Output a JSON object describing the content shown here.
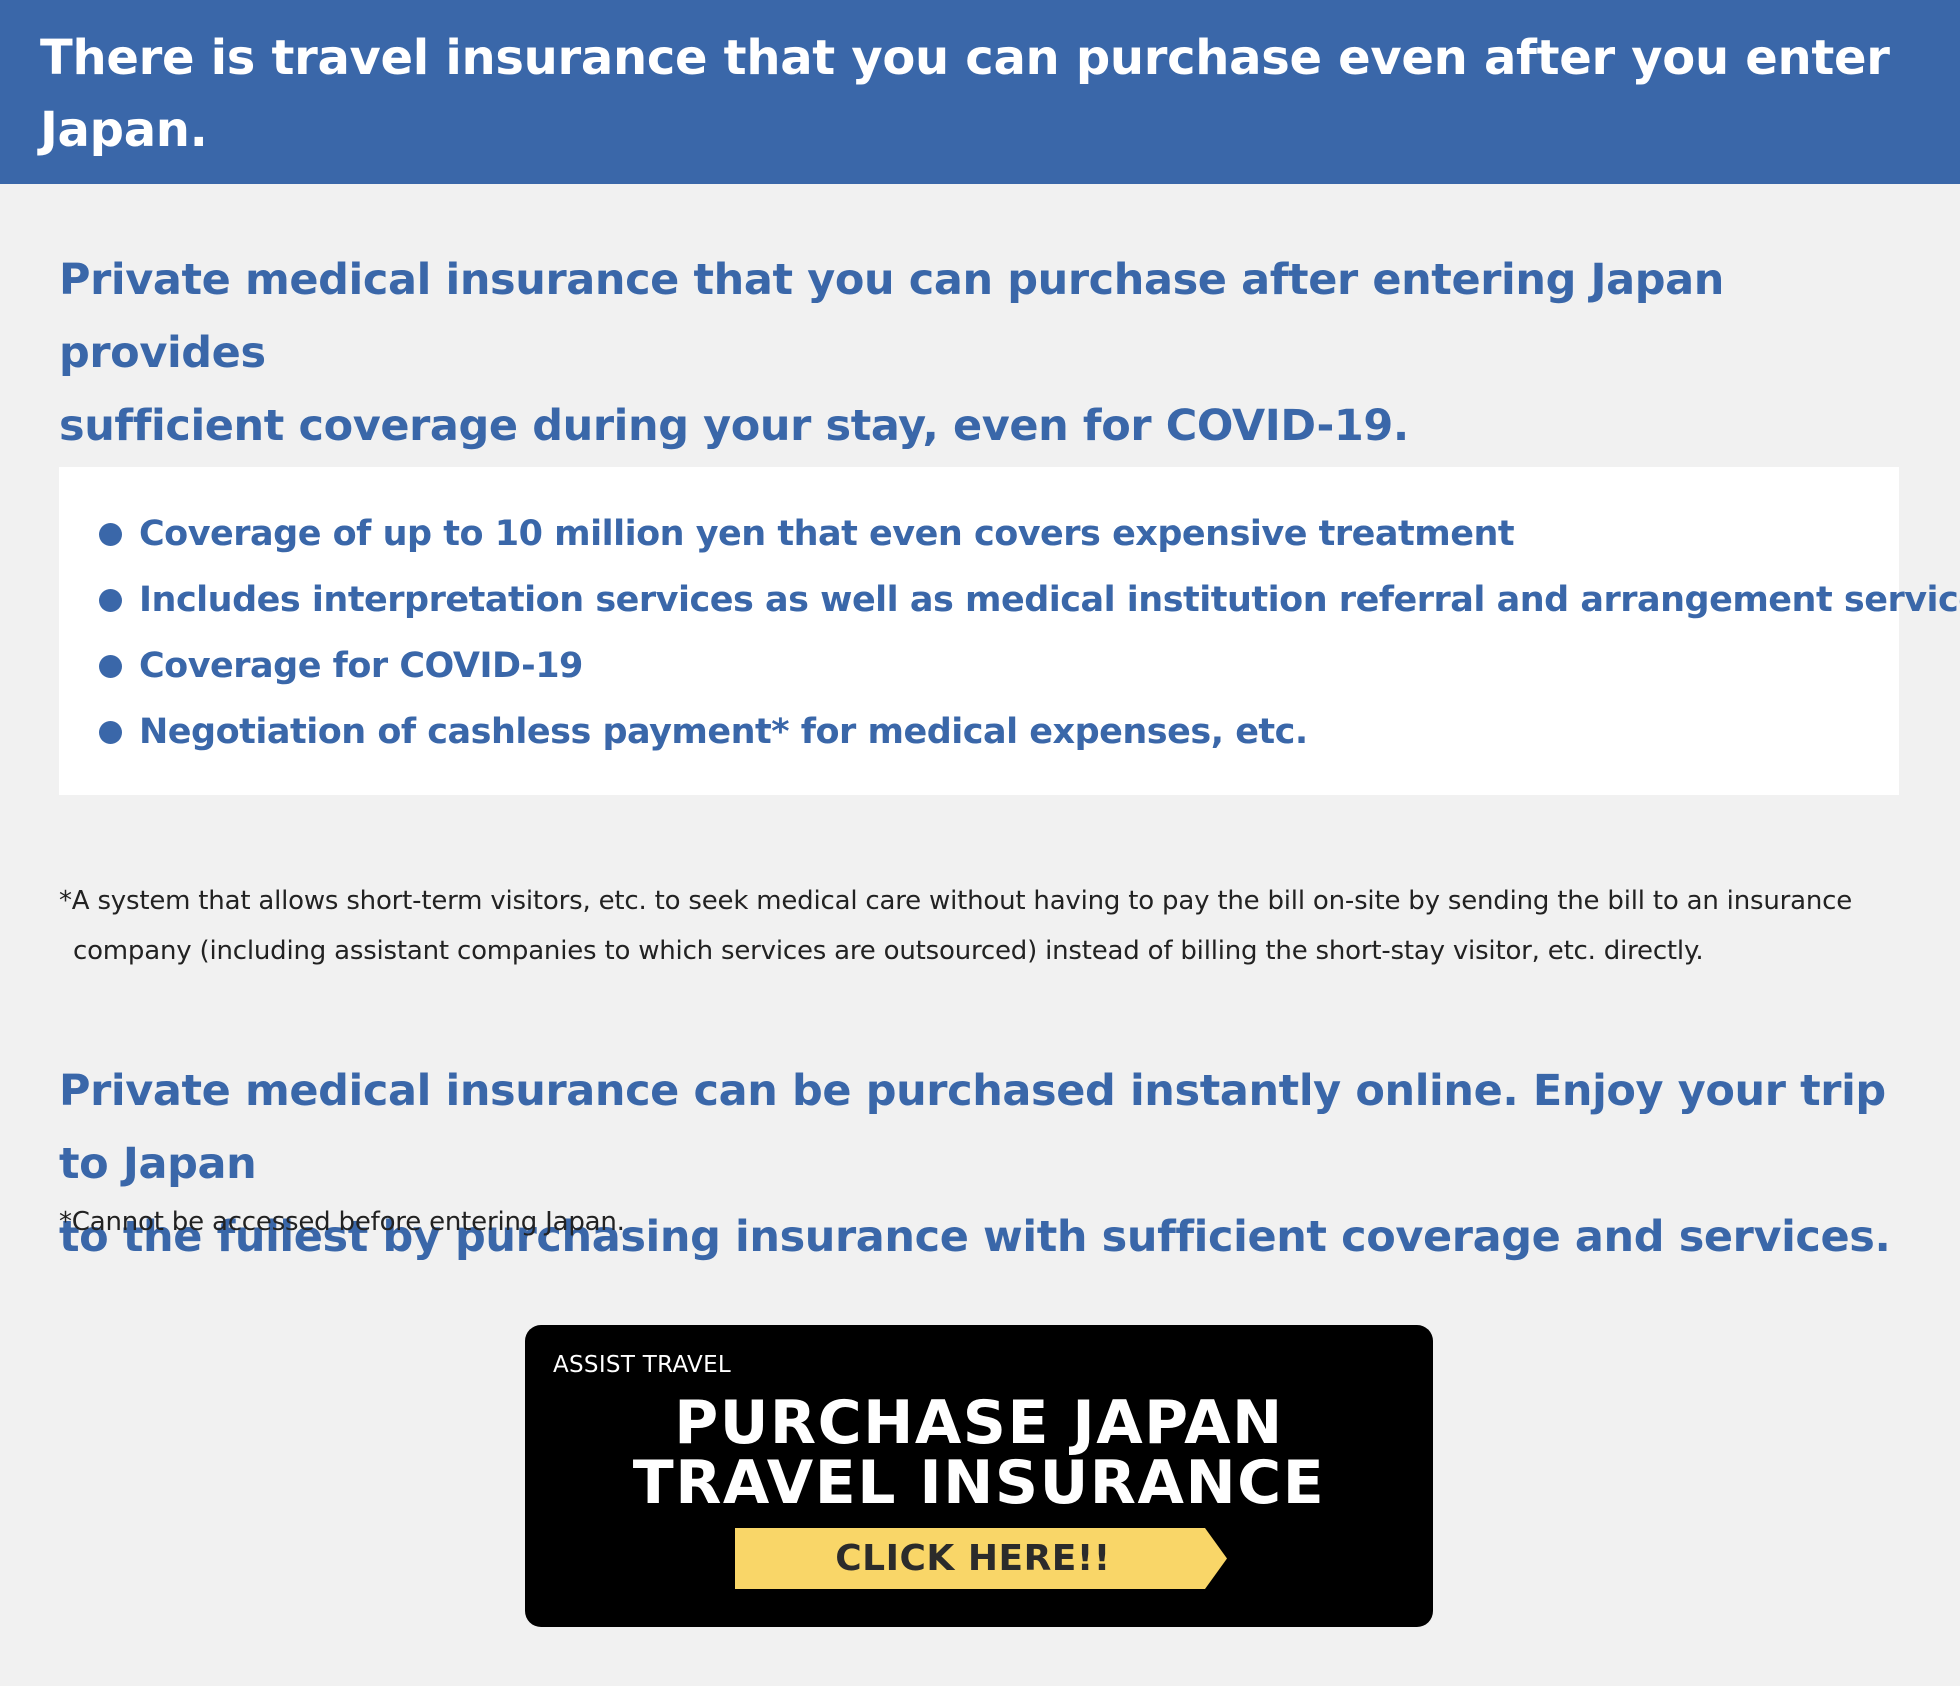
{
  "header": {
    "title": "There is travel insurance that you can purchase even after you enter\nJapan."
  },
  "intro": {
    "text": "Private medical insurance that you can purchase after entering Japan provides\nsufficient coverage during your stay, even for COVID-19."
  },
  "features": {
    "items": [
      "Coverage of up to 10 million yen that even covers expensive treatment",
      "Includes interpretation services as well as medical institution referral and arrangement services",
      "Coverage for COVID-19",
      "Negotiation of cashless payment* for medical expenses, etc."
    ]
  },
  "footnote": {
    "line1": "*A system that allows short-term visitors, etc. to seek medical care without having to pay the bill on-site by sending the bill to an insurance",
    "line2": "company (including assistant companies to which services are outsourced) instead of billing the short-stay visitor, etc. directly."
  },
  "online": {
    "text": "Private medical insurance can be purchased instantly online. Enjoy your trip to Japan\nto the fullest by purchasing insurance with sufficient coverage and services.",
    "note": "*Cannot be accessed before entering Japan."
  },
  "cta": {
    "brand": "ASSIST TRAVEL",
    "title_line1": "PURCHASE JAPAN",
    "title_line2": "TRAVEL INSURANCE",
    "button_label": "CLICK HERE!!",
    "button_color": "#f9d668",
    "background_color": "#000000"
  },
  "colors": {
    "brand_blue": "#3a67a9",
    "page_background": "#f1f1f1"
  }
}
